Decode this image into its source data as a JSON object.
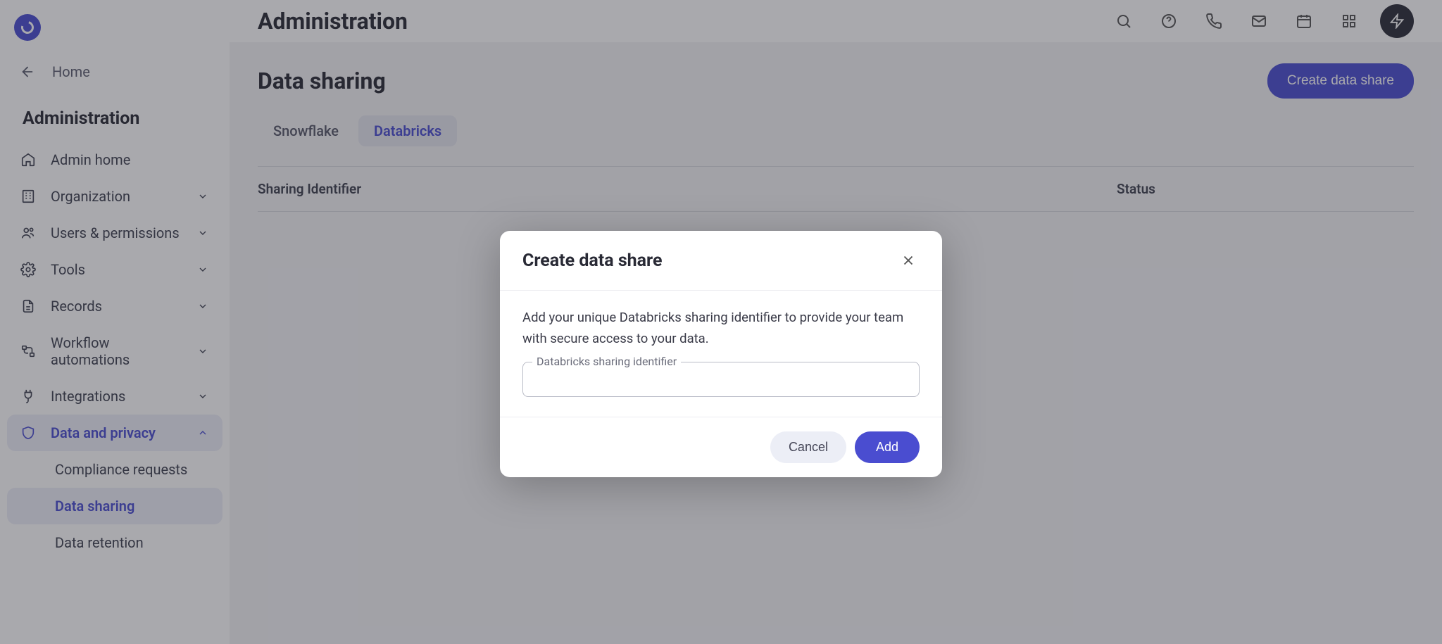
{
  "topbar": {
    "page_title": "Administration"
  },
  "sidebar": {
    "home_label": "Home",
    "section_title": "Administration",
    "items": [
      {
        "key": "admin-home",
        "label": "Admin home",
        "expandable": false
      },
      {
        "key": "organization",
        "label": "Organization",
        "expandable": true
      },
      {
        "key": "users-permissions",
        "label": "Users & permissions",
        "expandable": true
      },
      {
        "key": "tools",
        "label": "Tools",
        "expandable": true
      },
      {
        "key": "records",
        "label": "Records",
        "expandable": true
      },
      {
        "key": "workflow-automations",
        "label": "Workflow automations",
        "expandable": true
      },
      {
        "key": "integrations",
        "label": "Integrations",
        "expandable": true
      },
      {
        "key": "data-privacy",
        "label": "Data and privacy",
        "expandable": true,
        "expanded": true,
        "active": true
      }
    ],
    "data_privacy_children": [
      {
        "key": "compliance-requests",
        "label": "Compliance requests"
      },
      {
        "key": "data-sharing",
        "label": "Data sharing",
        "active": true
      },
      {
        "key": "data-retention",
        "label": "Data retention"
      }
    ]
  },
  "content": {
    "title": "Data sharing",
    "create_button": "Create data share",
    "tabs": [
      {
        "key": "snowflake",
        "label": "Snowflake"
      },
      {
        "key": "databricks",
        "label": "Databricks",
        "active": true
      }
    ],
    "columns": {
      "identifier": "Sharing Identifier",
      "status": "Status"
    }
  },
  "modal": {
    "title": "Create data share",
    "description": "Add your unique Databricks sharing identifier to provide your team with secure access to your data.",
    "field_label": "Databricks sharing identifier",
    "field_value": "",
    "cancel": "Cancel",
    "add": "Add"
  }
}
